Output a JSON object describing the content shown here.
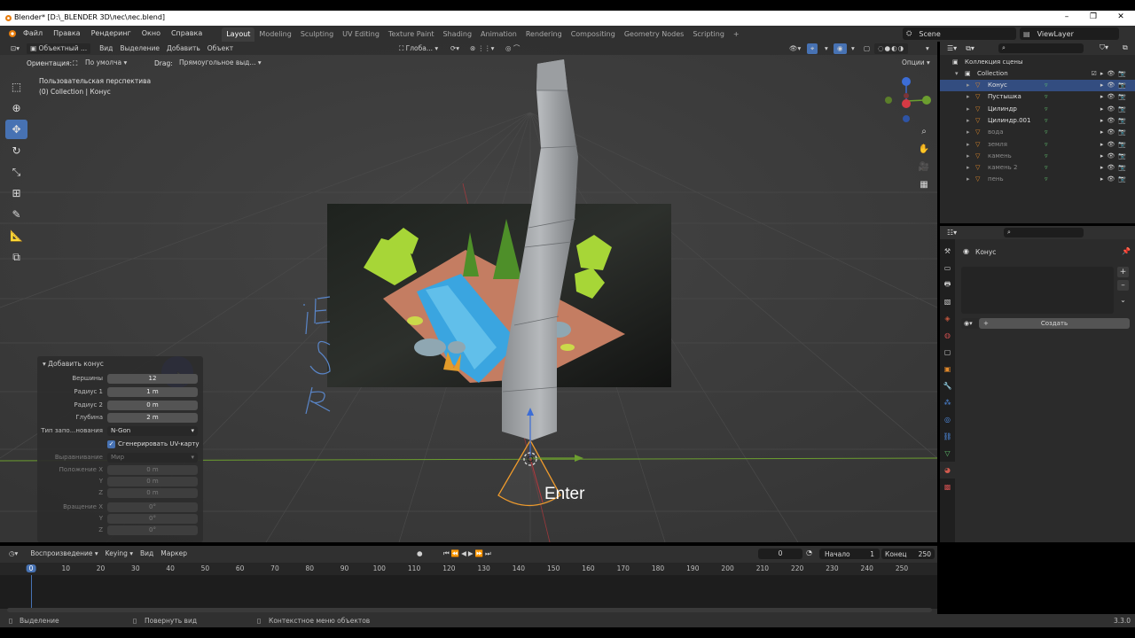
{
  "window": {
    "title": "Blender* [D:\\_BLENDER 3D\\лес\\лес.blend]",
    "controls": [
      "–",
      "❐",
      "✕"
    ]
  },
  "menu": {
    "items": [
      "Файл",
      "Правка",
      "Рендеринг",
      "Окно",
      "Справка"
    ],
    "workspaces": [
      "Layout",
      "Modeling",
      "Sculpting",
      "UV Editing",
      "Texture Paint",
      "Shading",
      "Animation",
      "Rendering",
      "Compositing",
      "Geometry Nodes",
      "Scripting"
    ],
    "active_workspace": "Layout",
    "add_tab": "+",
    "scene": "Scene",
    "view_layer": "ViewLayer"
  },
  "viewport": {
    "mode": "Объектный ...",
    "menus": [
      "Вид",
      "Выделение",
      "Добавить",
      "Объект"
    ],
    "transform_orientation": "Глоба...",
    "orientation_label": "Ориентация:",
    "orientation_value": "По умолча",
    "drag_label": "Drag:",
    "drag_value": "Прямоугольное выд...",
    "options": "Опции",
    "perspective": "Пользовательская перспектива",
    "collection_info": "(0) Collection | Конус",
    "key_hint": "Enter",
    "scribble": "iESR"
  },
  "redo_panel": {
    "title": "Добавить конус",
    "rows": [
      {
        "label": "Вершины",
        "value": "12"
      },
      {
        "label": "Радиус 1",
        "value": "1 m"
      },
      {
        "label": "Радиус 2",
        "value": "0 m"
      },
      {
        "label": "Глубина",
        "value": "2 m"
      }
    ],
    "fill_label": "Тип запо...нования",
    "fill_value": "N-Gon",
    "uv_label": "Сгенерировать UV-карту",
    "align_label": "Выравнивание",
    "align_value": "Мир",
    "location": [
      {
        "label": "Положение X",
        "value": "0 m"
      },
      {
        "label": "Y",
        "value": "0 m"
      },
      {
        "label": "Z",
        "value": "0 m"
      }
    ],
    "rotation": [
      {
        "label": "Вращение X",
        "value": "0°"
      },
      {
        "label": "Y",
        "value": "0°"
      },
      {
        "label": "Z",
        "value": "0°"
      }
    ]
  },
  "outliner": {
    "root": "Коллекция сцены",
    "collection": "Collection",
    "items": [
      {
        "name": "Конус",
        "selected": true
      },
      {
        "name": "Пустышка",
        "selected": false
      },
      {
        "name": "Цилиндр",
        "selected": false
      },
      {
        "name": "Цилиндр.001",
        "selected": false
      },
      {
        "name": "вода",
        "selected": false
      },
      {
        "name": "земля",
        "selected": false
      },
      {
        "name": "камень",
        "selected": false
      },
      {
        "name": "камень 2",
        "selected": false
      },
      {
        "name": "пень",
        "selected": false
      }
    ]
  },
  "properties": {
    "object_name": "Конус",
    "create_button": "Создать"
  },
  "timeline": {
    "menus": [
      "Воспроизведение",
      "Keying",
      "Вид",
      "Маркер"
    ],
    "current_frame": "0",
    "start_label": "Начало",
    "start_value": "1",
    "end_label": "Конец",
    "end_value": "250",
    "ticks": [
      "0",
      "10",
      "20",
      "30",
      "40",
      "50",
      "60",
      "70",
      "80",
      "90",
      "100",
      "110",
      "120",
      "130",
      "140",
      "150",
      "160",
      "170",
      "180",
      "190",
      "200",
      "210",
      "220",
      "230",
      "240",
      "250"
    ]
  },
  "status": {
    "select": "Выделение",
    "rotate": "Повернуть вид",
    "context": "Контекстное меню объектов",
    "version": "3.3.0"
  },
  "colors": {
    "accent": "#4772b3",
    "selection": "#334d80",
    "viewport_bg": "#3b3b3b",
    "x_axis": "#b5383d",
    "y_axis": "#6c9e2f",
    "z_axis": "#3c6dd6",
    "cursor_dot": "#2b3de0"
  }
}
